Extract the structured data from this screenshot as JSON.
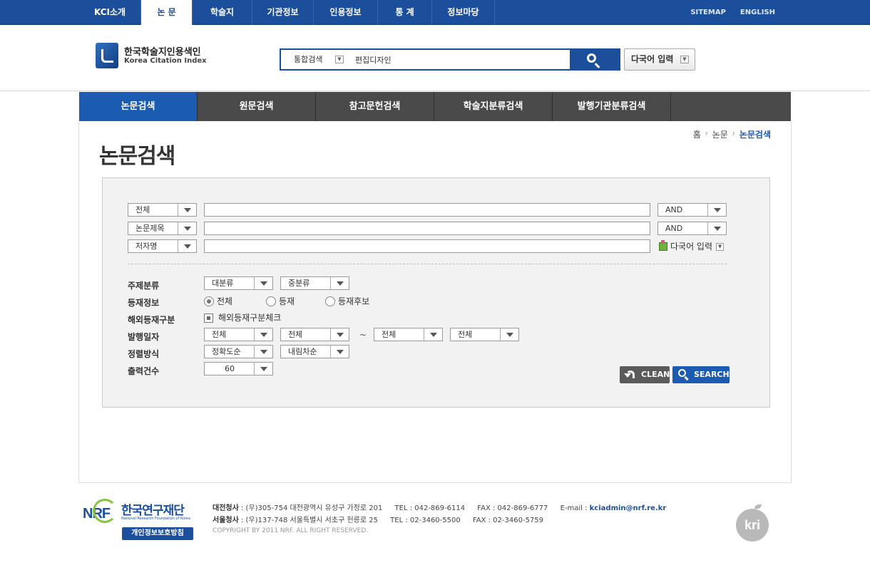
{
  "topnav": {
    "tabs": [
      {
        "label": "KCI소개"
      },
      {
        "label": "논 문"
      },
      {
        "label": "학술지"
      },
      {
        "label": "기관정보"
      },
      {
        "label": "인용정보"
      },
      {
        "label": "통 계"
      },
      {
        "label": "정보마당"
      }
    ],
    "active_index": 1,
    "links": [
      "SITEMAP",
      "ENGLISH"
    ]
  },
  "header": {
    "logo_ko": "한국학술지인용색인",
    "logo_en": "Korea Citation Index",
    "scope": "통합검색",
    "query": "편집디자인",
    "multilang": "다국어 입력"
  },
  "subnav": {
    "items": [
      "논문검색",
      "원문검색",
      "참고문헌검색",
      "학술지분류검색",
      "발행기관분류검색"
    ],
    "active_index": 0
  },
  "breadcrumb": [
    "홈",
    "논문",
    "논문검색"
  ],
  "page_title": "논문검색",
  "form": {
    "rows": [
      {
        "field": "전체",
        "value": "",
        "op": "AND"
      },
      {
        "field": "논문제목",
        "value": "",
        "op": "AND"
      },
      {
        "field": "저자명",
        "value": ""
      }
    ],
    "multilang": "다국어 입력",
    "subject": {
      "label": "주제분류",
      "major": "대분류",
      "minor": "중분류"
    },
    "publication": {
      "label": "등재정보",
      "options": [
        "전체",
        "등재",
        "등재후보"
      ],
      "selected": "전체"
    },
    "overseas": {
      "label": "해외등재구분",
      "check_label": "해외등재구분체크",
      "checked": true
    },
    "date": {
      "label": "발행일자",
      "from_year": "전체",
      "from_month": "전체",
      "tilde": "~",
      "to_year": "전체",
      "to_month": "전체"
    },
    "sort": {
      "label": "정렬방식",
      "by": "정확도순",
      "order": "내림차순"
    },
    "count": {
      "label": "출력건수",
      "value": "60"
    },
    "clean": "CLEAN",
    "search": "SEARCH"
  },
  "footer": {
    "org_ko": "한국연구재단",
    "org_en": "National Research Foundation of Korea",
    "privacy": "개인정보보호방침",
    "daejeon": {
      "name": "대전청사",
      "addr": " : (우)305-754 대전광역시 유성구 가정로 201",
      "tel": "TEL : 042-869-6114",
      "fax": "FAX : 042-869-6777",
      "email_label": "E-mail : ",
      "email": "kciadmin@nrf.re.kr"
    },
    "seoul": {
      "name": "서울청사",
      "addr": " : (우)137-748 서울특별시 서초구 헌릉로 25",
      "tel": "TEL : 02-3460-5500",
      "fax": "FAX : 02-3460-5759"
    },
    "copyright": "COPYRIGHT BY 2011 NRF. ALL RIGHT RESERVED.",
    "kri": "kri"
  },
  "colors": {
    "brand_blue": "#1b4f9c",
    "active_blue": "#1b5bb1",
    "subnav_gray": "#4a4a4a"
  }
}
